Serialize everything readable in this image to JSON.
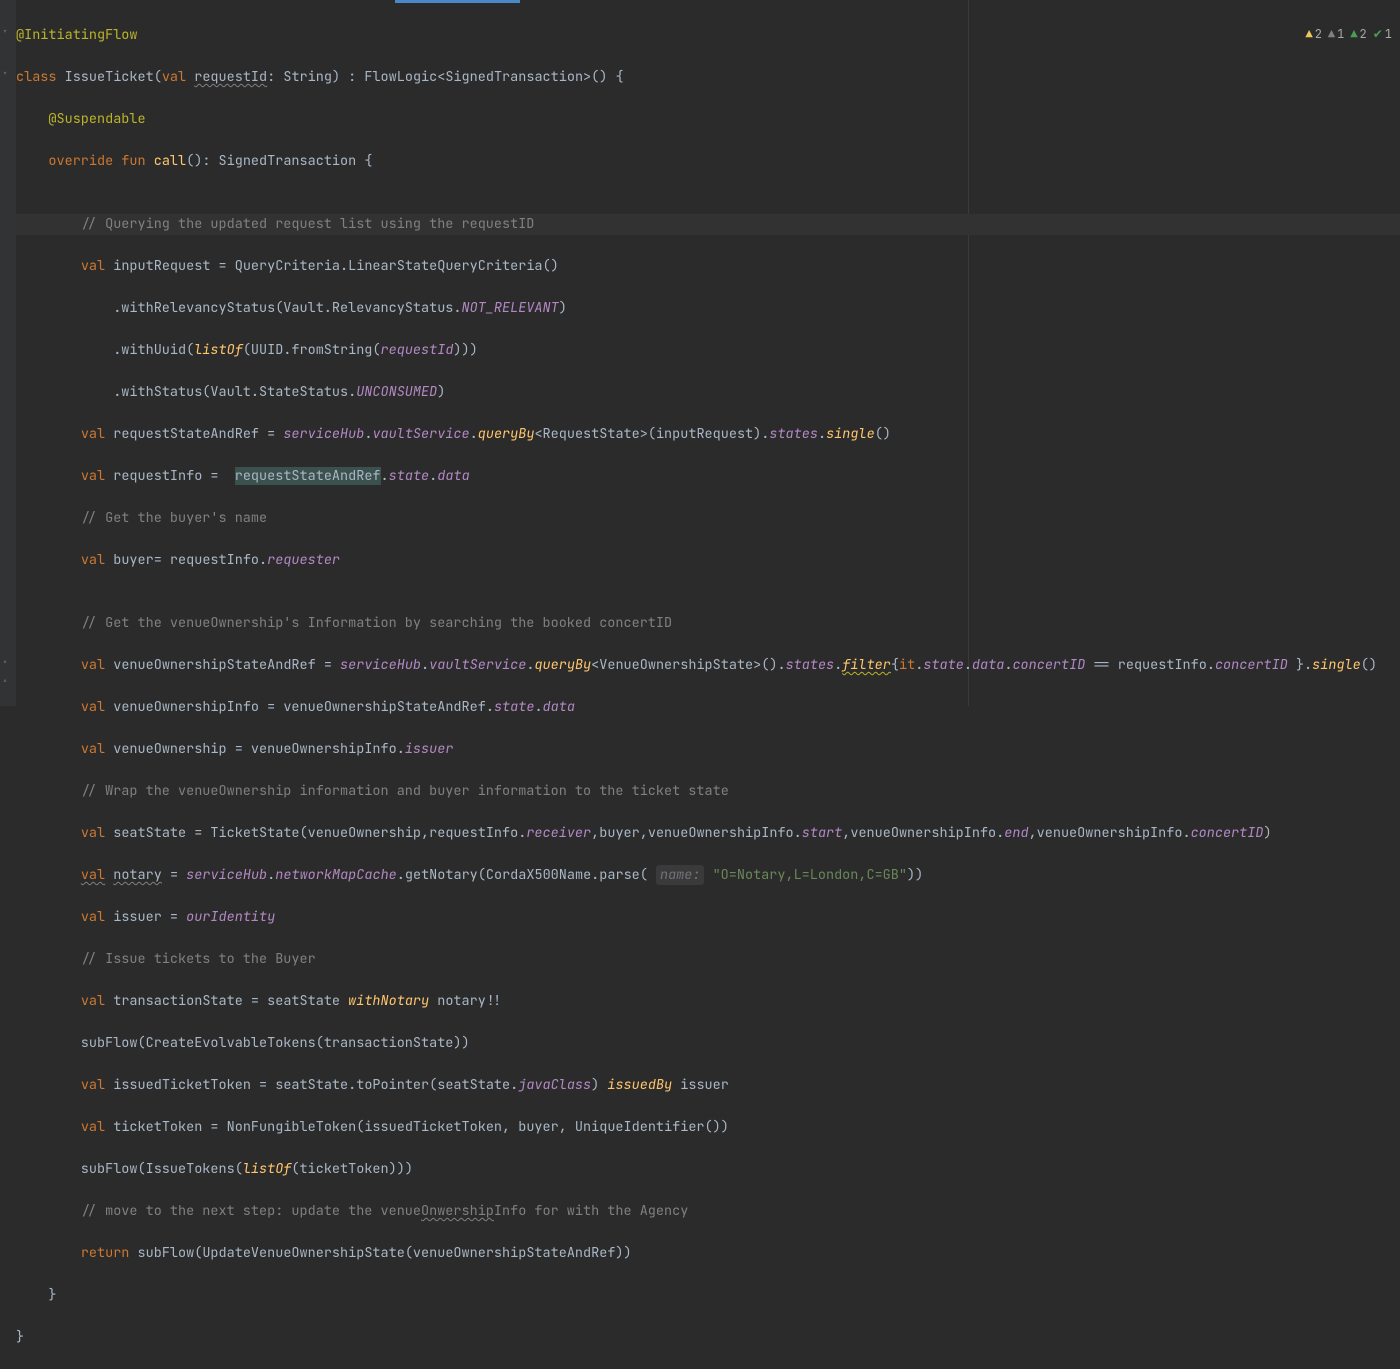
{
  "status": {
    "warn_yellow": "2",
    "warn_gray": "1",
    "warn_green": "2",
    "check": "1"
  },
  "c": {
    "l00": "@InitiatingFlow",
    "l01a": "class",
    "l01b": " IssueTicket(",
    "l01c": "val",
    "l01d": " ",
    "l01e": "requestId",
    "l01f": ": String) : FlowLogic<SignedTransaction>() {",
    "l02": "    @Suspendable",
    "l03a": "    ",
    "l03b": "override fun",
    "l03c": " ",
    "l03d": "call",
    "l03e": "(): SignedTransaction {",
    "l04": "",
    "l05": "        // Querying the updated request list using the requestID",
    "l06a": "        ",
    "l06b": "val",
    "l06c": " inputRequest = QueryCriteria.LinearStateQueryCriteria()",
    "l07a": "            .withRelevancyStatus(Vault.RelevancyStatus.",
    "l07b": "NOT_RELEVANT",
    "l07c": ")",
    "l08a": "            .withUuid(",
    "l08b": "listOf",
    "l08c": "(UUID.fromString(",
    "l08d": "requestId",
    "l08e": ")))",
    "l09a": "            .withStatus(Vault.StateStatus.",
    "l09b": "UNCONSUMED",
    "l09c": ")",
    "l10a": "        ",
    "l10b": "val",
    "l10c": " reques",
    "l10d": "tStateAndRef = ",
    "l10e": "serviceHub",
    "l10f": ".",
    "l10g": "vaultService",
    "l10h": ".",
    "l10i": "queryBy",
    "l10j": "<RequestState>(inputRequest).",
    "l10k": "states",
    "l10l": ".",
    "l10m": "single",
    "l10n": "()",
    "l11a": "        ",
    "l11b": "val",
    "l11c": " requestInfo =  ",
    "l11d": "requestStateAndRef",
    "l11e": ".",
    "l11f": "state",
    "l11g": ".",
    "l11h": "data",
    "l12": "        // Get the buyer's name",
    "l13a": "        ",
    "l13b": "val",
    "l13c": " buyer= requestInfo.",
    "l13d": "requester",
    "l14": "",
    "l15": "        // Get the venueOwnership's Information by searching the booked concertID",
    "l16a": "        ",
    "l16b": "val",
    "l16c": " venueOwnershipStateAndRef = ",
    "l16d": "serviceHub",
    "l16e": ".",
    "l16f": "vaultService",
    "l16g": ".",
    "l16h": "queryBy",
    "l16i": "<VenueOwnershipState>().",
    "l16j": "states",
    "l16k": ".",
    "l16l": "filter",
    "l16m": "{",
    "l16n": "it",
    "l16o": ".",
    "l16p": "state",
    "l16q": ".",
    "l16r": "data",
    "l16s": ".",
    "l16t": "concertID",
    "l16u": " == requestInfo.",
    "l16v": "concertID",
    "l16w": " }.",
    "l16x": "single",
    "l16y": "()",
    "l17a": "        ",
    "l17b": "val",
    "l17c": " venueOwnershipInfo = venueOwnershipStateAndRef.",
    "l17d": "state",
    "l17e": ".",
    "l17f": "data",
    "l18a": "        ",
    "l18b": "val",
    "l18c": " venueOwnership = venueOwnershipInfo.",
    "l18d": "issuer",
    "l19": "        // Wrap the venueOwnership information and buyer information to the ticket state",
    "l20a": "        ",
    "l20b": "val",
    "l20c": " seatState = TicketState(venueOwnership,requestInfo.",
    "l20d": "receiver",
    "l20e": ",buyer,venueOwnershipInfo.",
    "l20f": "start",
    "l20g": ",venueOwnershipInfo.",
    "l20h": "end",
    "l20i": ",venueOwnershipInfo.",
    "l20j": "concertID",
    "l20k": ")",
    "l21a": "        ",
    "l21b": "val",
    "l21bu": " ",
    "l21bx": "notary",
    "l21c": " = ",
    "l21d": "serviceHub",
    "l21e": ".",
    "l21f": "networkMapCache",
    "l21g": ".getNotary(CordaX500Name.parse( ",
    "l21h": "name:",
    "l21i": " ",
    "l21j": "\"O=Notary,L=London,C=GB\"",
    "l21k": "))",
    "l22a": "        ",
    "l22b": "val",
    "l22c": " issuer = ",
    "l22d": "ourIdentity",
    "l23": "        // Issue tickets to the Buyer",
    "l24a": "        ",
    "l24b": "val",
    "l24c": " transactionState = seatState ",
    "l24d": "withNotary",
    "l24e": " notary!!",
    "l25": "        subFlow(CreateEvolvableTokens(transactionState))",
    "l26a": "        ",
    "l26b": "val",
    "l26c": " issuedTicketToken = seatState.toPointer(seatState.",
    "l26d": "javaClass",
    "l26e": ") ",
    "l26f": "issuedBy",
    "l26g": " issuer",
    "l27a": "        ",
    "l27b": "val",
    "l27c": " ticketToken = NonFungibleToken(issuedTicketToken, buyer, UniqueIdentifier())",
    "l28a": "        subFlow(IssueTokens(",
    "l28b": "listOf",
    "l28c": "(ticketToken)))",
    "l29a": "        // move to the next step: update the venue",
    "l29b": "Onwership",
    "l29c": "Info for with the Agency",
    "l30a": "        ",
    "l30b": "return",
    "l30c": " subFlow(UpdateVenueOwnershipState(venueOwnershipStateAndRef))",
    "l31": "    }",
    "l32": "}"
  }
}
